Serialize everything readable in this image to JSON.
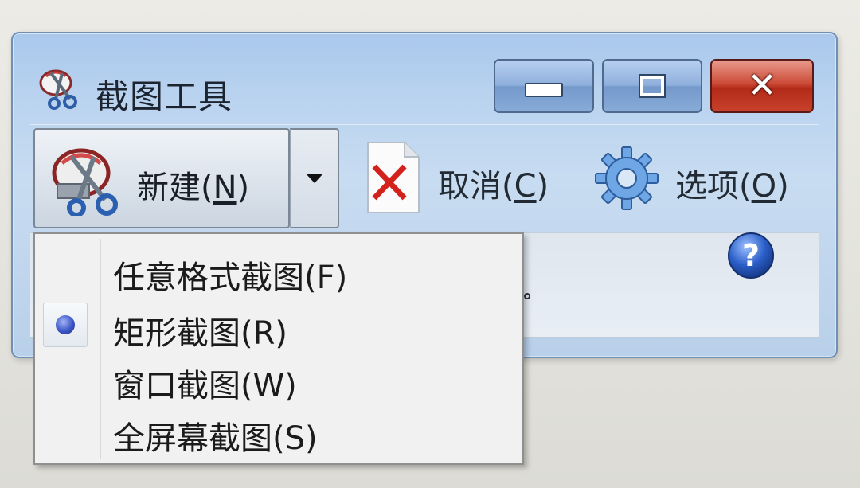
{
  "window": {
    "title": "截图工具",
    "app_icon": "scissors-icon"
  },
  "title_bar_buttons": {
    "minimize": {
      "icon": "minimize-icon"
    },
    "maximize": {
      "icon": "maximize-icon"
    },
    "close": {
      "icon": "close-icon",
      "glyph": "✕"
    }
  },
  "toolbar": {
    "new": {
      "label_prefix": "新建(",
      "mnemonic": "N",
      "label_suffix": ")",
      "icon": "scissors-icon"
    },
    "new_dropdown": {
      "icon": "chevron-down-icon"
    },
    "cancel": {
      "label_prefix": "取消(",
      "mnemonic": "C",
      "label_suffix": ")",
      "icon": "cancel-icon"
    },
    "options": {
      "label_prefix": "选项(",
      "mnemonic": "O",
      "label_suffix": ")",
      "icon": "gear-icon"
    }
  },
  "help": {
    "icon": "help-icon",
    "glyph": "?"
  },
  "snip_menu": {
    "items": [
      {
        "label": "任意格式截图(F)",
        "selected": false
      },
      {
        "label": "矩形截图(R)",
        "selected": true
      },
      {
        "label": "窗口截图(W)",
        "selected": false
      },
      {
        "label": "全屏幕截图(S)",
        "selected": false
      }
    ]
  },
  "colors": {
    "title_bar": "#b8d2ef",
    "close_button": "#c7412b",
    "radio_selected": "#3c56c8",
    "menu_background": "#f1f1f1"
  }
}
